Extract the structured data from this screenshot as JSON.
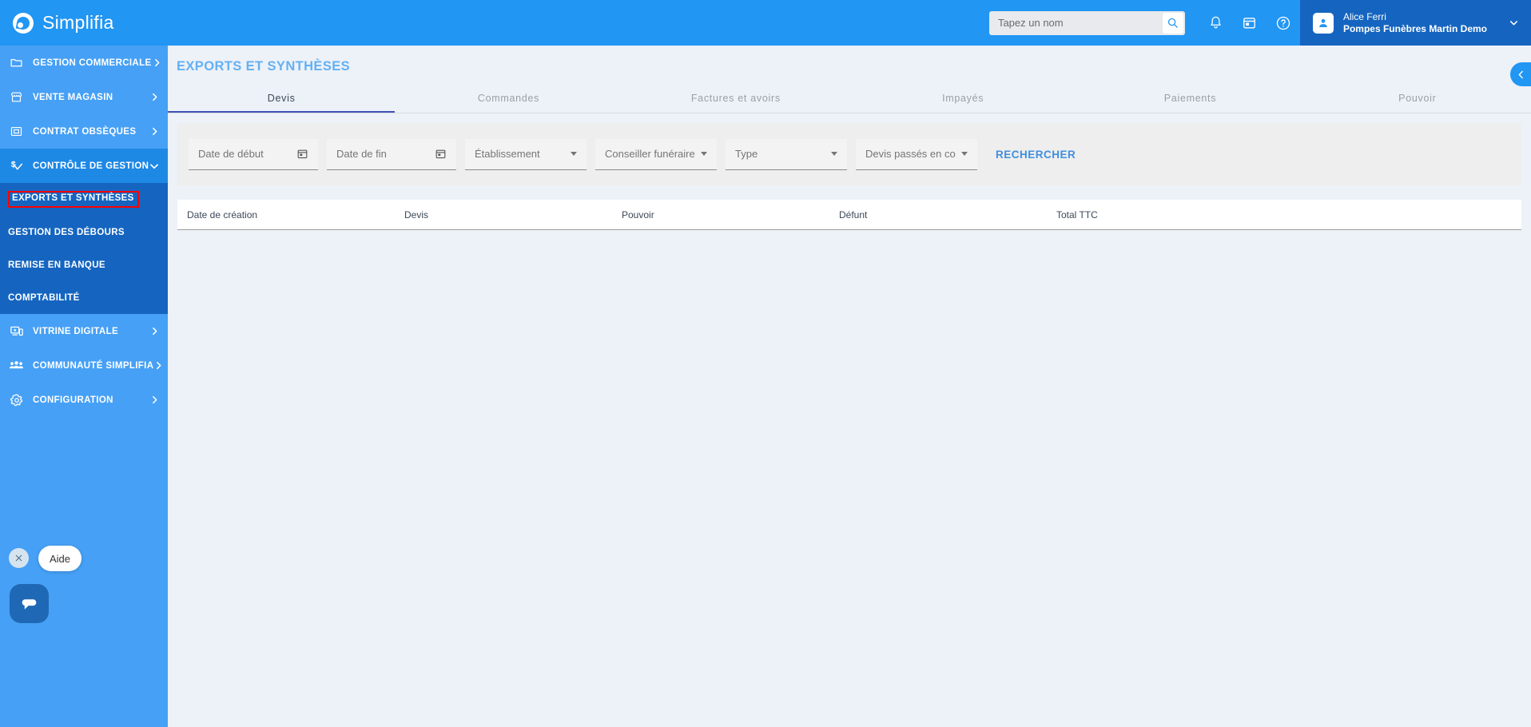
{
  "header": {
    "brand": "Simplifia",
    "search": {
      "placeholder": "Tapez un nom",
      "value": ""
    },
    "icons": {
      "search": "search-icon",
      "notifications": "bell-icon",
      "calendar": "calendar-icon",
      "help": "help-circle-icon",
      "caret": "chevron-down-icon"
    },
    "user": {
      "name": "Alice Ferri",
      "organization": "Pompes Funèbres Martin Demo",
      "avatar_icon": "person-icon"
    }
  },
  "sidebar": {
    "items": [
      {
        "label": "GESTION COMMERCIALE",
        "icon": "folder-icon",
        "state": "collapsed",
        "chevron": "chevron-right-icon"
      },
      {
        "label": "VENTE MAGASIN",
        "icon": "storefront-icon",
        "state": "collapsed",
        "chevron": "chevron-right-icon"
      },
      {
        "label": "CONTRAT OBSÈQUES",
        "icon": "contract-card-icon",
        "state": "collapsed",
        "chevron": "chevron-right-icon"
      },
      {
        "label": "CONTRÔLE DE GESTION",
        "icon": "price-check-icon",
        "state": "expanded",
        "chevron": "chevron-down-icon"
      }
    ],
    "submenu": [
      {
        "label": "EXPORTS ET SYNTHÈSES",
        "highlighted": true
      },
      {
        "label": "GESTION DES DÉBOURS",
        "highlighted": false
      },
      {
        "label": "REMISE EN BANQUE",
        "highlighted": false
      },
      {
        "label": "COMPTABILITÉ",
        "highlighted": false
      }
    ],
    "items_bottom": [
      {
        "label": "VITRINE DIGITALE",
        "icon": "desktop-star-icon",
        "chevron": "chevron-right-icon"
      },
      {
        "label": "COMMUNAUTÉ SIMPLIFIA",
        "icon": "group-icon",
        "chevron": "chevron-right-icon"
      },
      {
        "label": "CONFIGURATION",
        "icon": "gear-icon",
        "chevron": "chevron-right-icon"
      }
    ]
  },
  "main": {
    "title": "EXPORTS ET SYNTHÈSES",
    "tabs": [
      {
        "label": "Devis",
        "active": true
      },
      {
        "label": "Commandes",
        "active": false
      },
      {
        "label": "Factures et avoirs",
        "active": false
      },
      {
        "label": "Impayés",
        "active": false
      },
      {
        "label": "Paiements",
        "active": false
      },
      {
        "label": "Pouvoir",
        "active": false
      }
    ],
    "filters": {
      "date_start": {
        "placeholder": "Date de début",
        "value": "",
        "icon": "calendar-icon"
      },
      "date_end": {
        "placeholder": "Date de fin",
        "value": "",
        "icon": "calendar-icon"
      },
      "establishment": {
        "label": "Établissement",
        "value": ""
      },
      "advisor": {
        "label": "Conseiller funéraire",
        "value": ""
      },
      "type": {
        "label": "Type",
        "value": ""
      },
      "status": {
        "label": "Devis passés en co…",
        "value": "Devis passés en co…"
      },
      "search_button": "RECHERCHER"
    },
    "table": {
      "columns": [
        "Date de création",
        "Devis",
        "Pouvoir",
        "Défunt",
        "Total TTC"
      ],
      "rows": []
    },
    "collapse_handle_icon": "chevron-left-icon"
  },
  "chat_widget": {
    "close_label": "×",
    "close_icon": "close-icon",
    "help_label": "Aide",
    "bubble_icon": "chat-bubble-icon"
  },
  "colors": {
    "header_blue": "#2196f3",
    "sidebar_blue": "#46a0f5",
    "sidebar_expanded": "#1e88e5",
    "submenu_navy": "#1565c0",
    "page_bg": "#edf1f8",
    "accent_link": "#3f8fe0",
    "title_blue": "#64b0f2",
    "highlight_red": "#ff0000",
    "tab_active_underline": "#3f51b5"
  }
}
